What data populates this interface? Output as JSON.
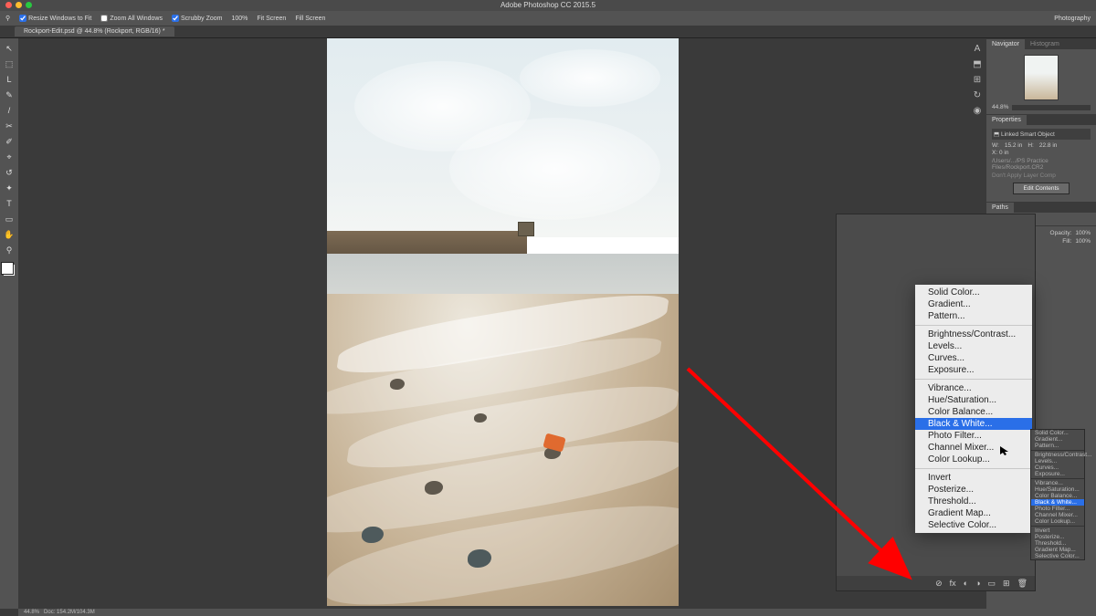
{
  "app": {
    "title": "Adobe Photoshop CC 2015.5"
  },
  "optionbar": {
    "resize": "Resize Windows to Fit",
    "zoom_all": "Zoom All Windows",
    "scrubby": "Scrubby Zoom",
    "zoom_pct": "100%",
    "fit_screen": "Fit Screen",
    "fill_screen": "Fill Screen",
    "workspace": "Photography"
  },
  "document": {
    "tab_label": "Rockport-Edit.psd @ 44.8% (Rockport, RGB/16) *",
    "status_zoom": "44.8%",
    "status_doc": "Doc: 154.2M/104.3M"
  },
  "tools": [
    "↖",
    "⬚",
    "L",
    "✎",
    "/",
    "✂",
    "✐",
    "⌖",
    "↺",
    "✦",
    "T",
    "▭",
    "✋",
    "⚲"
  ],
  "right_icons": [
    "A",
    "⬒",
    "⊞",
    "↻",
    "◉"
  ],
  "panels": {
    "navigator": {
      "tab1": "Navigator",
      "tab2": "Histogram",
      "zoom": "44.8%"
    },
    "properties": {
      "tab": "Properties",
      "kind": "Linked Smart Object",
      "w_label": "W:",
      "w_val": "15.2 in",
      "h_label": "H:",
      "h_val": "22.8 in",
      "x_label": "X:",
      "x_val": "0 in",
      "path": "/Users/.../PS Practice Files/Rockport.CR2",
      "apply_comp": "Don't Apply Layer Comp",
      "edit_contents": "Edit Contents"
    },
    "paths": {
      "tab": "Paths"
    },
    "layers": {
      "opacity_label": "Opacity:",
      "opacity_val": "100%",
      "fill_label": "Fill:",
      "fill_val": "100%"
    },
    "layers_footer_icons": [
      "⊘",
      "fx",
      "◐",
      "◑",
      "▭",
      "⊞",
      "🗑"
    ]
  },
  "adj_menu": {
    "g1": [
      "Solid Color...",
      "Gradient...",
      "Pattern..."
    ],
    "g2": [
      "Brightness/Contrast...",
      "Levels...",
      "Curves...",
      "Exposure..."
    ],
    "g3": [
      "Vibrance...",
      "Hue/Saturation...",
      "Color Balance...",
      "Black & White...",
      "Photo Filter...",
      "Channel Mixer...",
      "Color Lookup..."
    ],
    "g4": [
      "Invert",
      "Posterize...",
      "Threshold...",
      "Gradient Map...",
      "Selective Color..."
    ],
    "selected": "Black & White..."
  }
}
